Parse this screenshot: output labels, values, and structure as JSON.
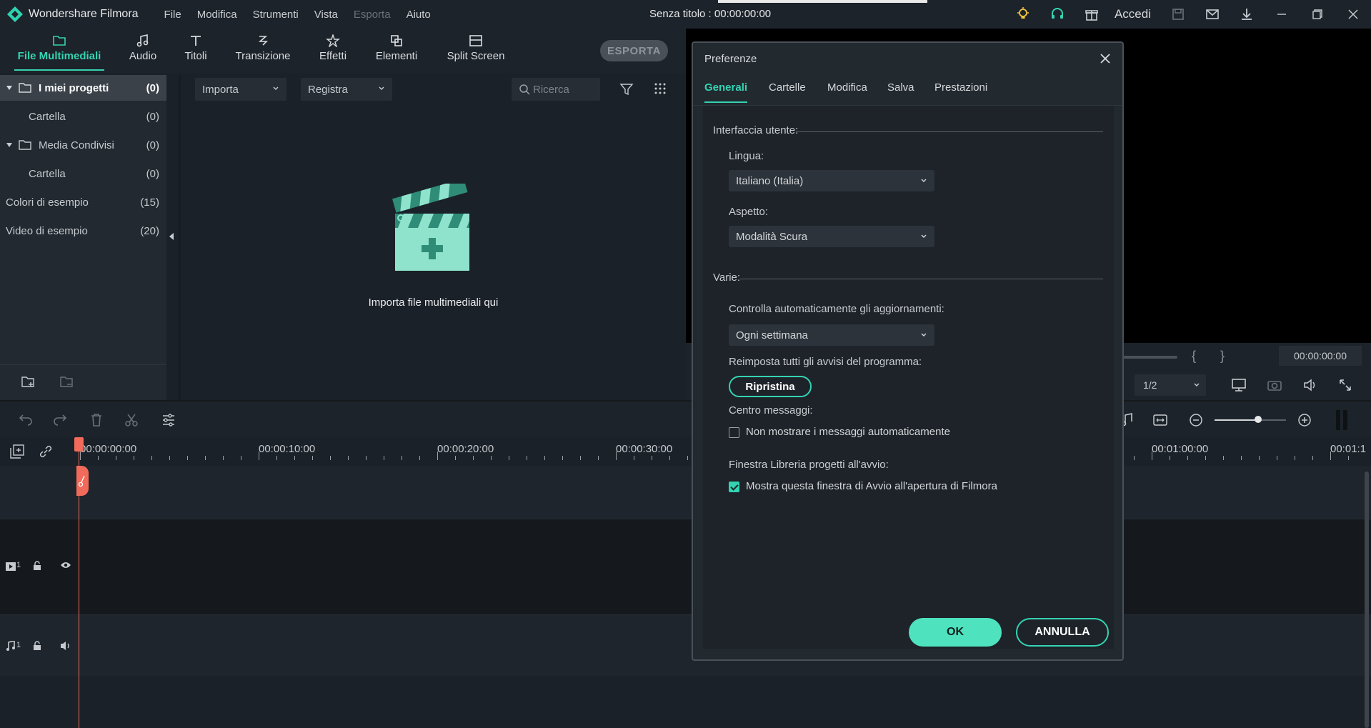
{
  "app": {
    "name": "Wondershare Filmora",
    "doc_title": "Senza titolo : 00:00:00:00",
    "login": "Accedi"
  },
  "menu": [
    "File",
    "Modifica",
    "Strumenti",
    "Vista",
    "Esporta",
    "Aiuto"
  ],
  "tabs": [
    {
      "label": "File Multimediali",
      "icon": "folder-icon",
      "active": true
    },
    {
      "label": "Audio",
      "icon": "music-note-icon",
      "active": false
    },
    {
      "label": "Titoli",
      "icon": "text-icon",
      "active": false
    },
    {
      "label": "Transizione",
      "icon": "transition-icon",
      "active": false
    },
    {
      "label": "Effetti",
      "icon": "effects-icon",
      "active": false
    },
    {
      "label": "Elementi",
      "icon": "elements-icon",
      "active": false
    },
    {
      "label": "Split Screen",
      "icon": "split-screen-icon",
      "active": false
    }
  ],
  "export_label": "ESPORTA",
  "sidebar": {
    "items": [
      {
        "label": "I miei progetti",
        "count": "(0)"
      },
      {
        "label": "Cartella",
        "count": "(0)"
      },
      {
        "label": "Media Condivisi",
        "count": "(0)"
      },
      {
        "label": "Cartella",
        "count": "(0)"
      },
      {
        "label": "Colori di esempio",
        "count": "(15)"
      },
      {
        "label": "Video di esempio",
        "count": "(20)"
      }
    ]
  },
  "media": {
    "import_label": "Importa",
    "record_label": "Registra",
    "search_placeholder": "Ricerca",
    "drop_hint": "Importa file multimediali qui"
  },
  "preview": {
    "timecode": "00:00:00:00",
    "ratio": "1/2"
  },
  "timeline": {
    "timecodes": [
      "00:00:00:00",
      "00:00:10:00",
      "00:00:20:00",
      "00:00:30:00",
      "00:01:00:00",
      "00:01:1"
    ],
    "video_track": "1",
    "audio_track": "1"
  },
  "dialog": {
    "title": "Preferenze",
    "tabs": [
      "Generali",
      "Cartelle",
      "Modifica",
      "Salva",
      "Prestazioni"
    ],
    "section_ui": "Interfaccia utente:",
    "language_label": "Lingua:",
    "language_value": "Italiano (Italia)",
    "appearance_label": "Aspetto:",
    "appearance_value": "Modalità Scura",
    "section_misc": "Varie:",
    "updates_label": "Controlla automaticamente gli aggiornamenti:",
    "updates_value": "Ogni settimana",
    "reset_label": "Reimposta tutti gli avvisi del programma:",
    "reset_button": "Ripristina",
    "messages_label": "Centro messaggi:",
    "messages_checkbox": "Non mostrare i messaggi automaticamente",
    "messages_checked": false,
    "library_label": "Finestra Libreria progetti all'avvio:",
    "library_checkbox": "Mostra questa finestra di Avvio all'apertura di Filmora",
    "library_checked": true,
    "ok": "OK",
    "cancel": "ANNULLA"
  },
  "colors": {
    "accent": "#34d3b2",
    "playhead": "#f26b5a"
  }
}
